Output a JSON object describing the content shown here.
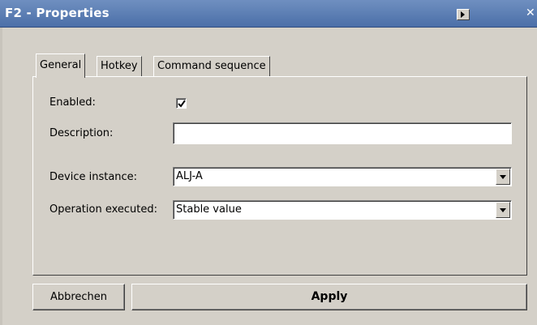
{
  "window": {
    "title": "F2 - Properties",
    "menu_icon": "triangle-right-icon",
    "close_icon": "close-icon"
  },
  "tabs": [
    {
      "label": "General",
      "active": true
    },
    {
      "label": "Hotkey",
      "active": false
    },
    {
      "label": "Command sequence",
      "active": false
    }
  ],
  "form": {
    "enabled_label": "Enabled:",
    "enabled_checked": true,
    "description_label": "Description:",
    "description_value": "",
    "device_instance_label": "Device instance:",
    "device_instance_value": "ALJ-A",
    "operation_label": "Operation executed:",
    "operation_value": "Stable value"
  },
  "buttons": {
    "cancel_label": "Abbrechen",
    "apply_label": "Apply"
  },
  "colors": {
    "titlebar": "#4b6fa8",
    "face": "#d4d0c8"
  }
}
